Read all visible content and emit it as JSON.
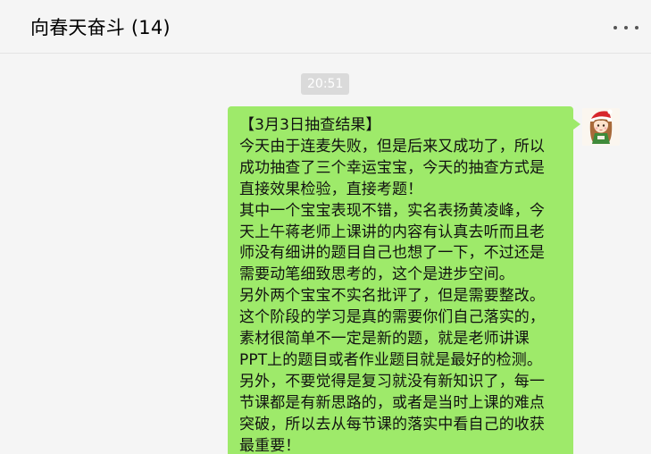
{
  "header": {
    "title": "向春天奋斗 (14)",
    "more_icon": "more-dots-icon"
  },
  "window_controls": [
    "pin-icon",
    "minimize-icon",
    "maximize-icon",
    "close-icon"
  ],
  "chat": {
    "timestamp": "20:51",
    "message": {
      "sender": "self",
      "bubble_color": "#9eea6a",
      "lines": [
        "【3月3日抽查结果】",
        "今天由于连麦失败，但是后来又成功了，所以",
        "成功抽查了三个幸运宝宝，今天的抽查方式是",
        "直接效果检验，直接考题！",
        "其中一个宝宝表现不错，实名表扬黄凌峰，今",
        "天上午蒋老师上课讲的内容有认真去听而且老",
        "师没有细讲的题目自己也想了一下，不过还是",
        "需要动笔细致思考的，这个是进步空间。",
        "另外两个宝宝不实名批评了，但是需要整改。",
        "这个阶段的学习是真的需要你们自己落实的，",
        "素材很简单不一定是新的题，就是老师讲课",
        "PPT上的题目或者作业题目就是最好的检测。",
        "另外，不要觉得是复习就没有新知识了，每一",
        "节课都是有新思路的，或者是当时上课的难点",
        "突破，所以去从每节课的落实中看自己的收获",
        "最重要！"
      ]
    }
  },
  "colors": {
    "background": "#f5f5f5",
    "bubble": "#9eea6a",
    "timestamp_bg": "#dadada"
  }
}
